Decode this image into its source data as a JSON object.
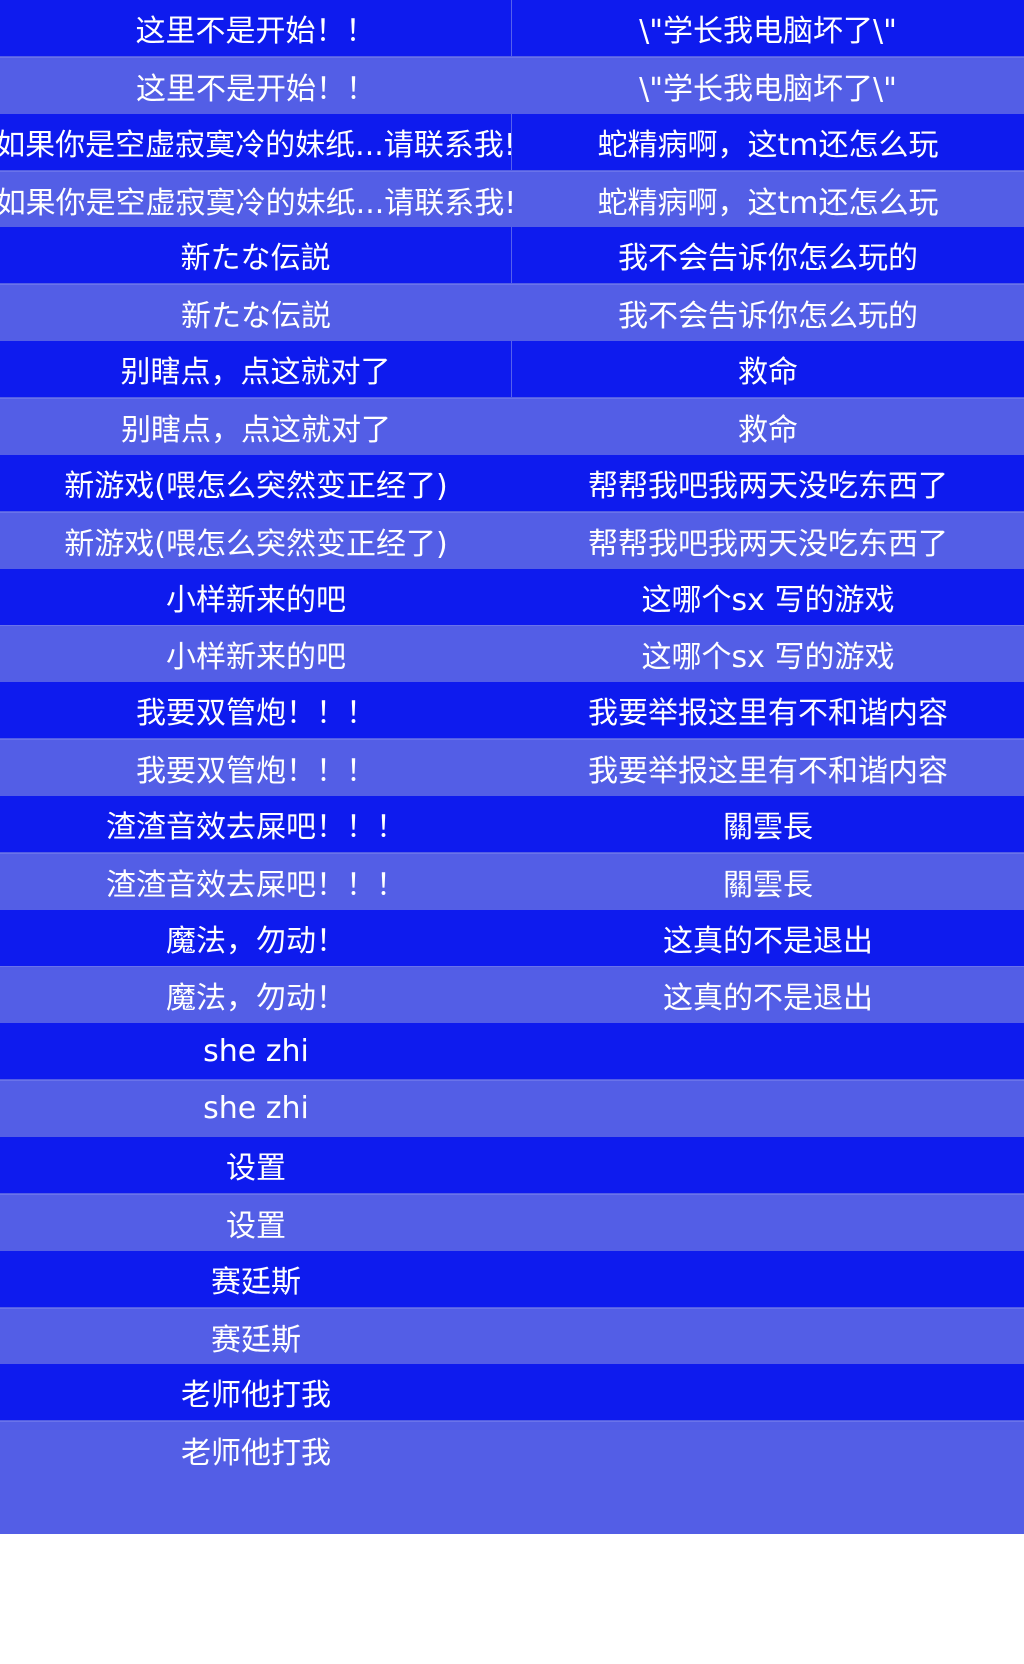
{
  "menu": {
    "rows": [
      {
        "left": "这里不是开始！！",
        "right": "\\\"学长我电脑坏了\\\""
      },
      {
        "left": "这里不是开始！！",
        "right": "\\\"学长我电脑坏了\\\""
      },
      {
        "left": "如果你是空虚寂寞冷的妹纸...请联系我!",
        "right": "蛇精病啊，这tm还怎么玩"
      },
      {
        "left": "如果你是空虚寂寞冷的妹纸...请联系我!",
        "right": "蛇精病啊，这tm还怎么玩"
      },
      {
        "left": "新たな伝説",
        "right": "我不会告诉你怎么玩的"
      },
      {
        "left": "新たな伝説",
        "right": "我不会告诉你怎么玩的"
      },
      {
        "left": "别瞎点，点这就对了",
        "right": "救命"
      },
      {
        "left": "别瞎点，点这就对了",
        "right": "救命"
      },
      {
        "left": "新游戏(喂怎么突然变正经了)",
        "right": "帮帮我吧我两天没吃东西了"
      },
      {
        "left": "新游戏(喂怎么突然变正经了)",
        "right": "帮帮我吧我两天没吃东西了"
      },
      {
        "left": "小样新来的吧",
        "right": "这哪个sx 写的游戏"
      },
      {
        "left": "小样新来的吧",
        "right": "这哪个sx 写的游戏"
      },
      {
        "left": "我要双管炮！！！",
        "right": "我要举报这里有不和谐内容"
      },
      {
        "left": "我要双管炮！！！",
        "right": "我要举报这里有不和谐内容"
      },
      {
        "left": "渣渣音效去屎吧！！！",
        "right": "關雲長"
      },
      {
        "left": "渣渣音效去屎吧！！！",
        "right": "關雲長"
      },
      {
        "left": "魔法，勿动！",
        "right": "这真的不是退出"
      },
      {
        "left": "魔法，勿动！",
        "right": "这真的不是退出"
      },
      {
        "left": "she zhi",
        "right": ""
      },
      {
        "left": "she zhi",
        "right": ""
      },
      {
        "left": "设置",
        "right": ""
      },
      {
        "left": "设置",
        "right": ""
      },
      {
        "left": "赛廷斯",
        "right": ""
      },
      {
        "left": "赛廷斯",
        "right": ""
      },
      {
        "left": "老师他打我",
        "right": ""
      },
      {
        "left": "老师他打我",
        "right": ""
      }
    ]
  },
  "colors": {
    "row_dark": "#0e1bee",
    "row_light": "#535ee6",
    "text": "#ffffff",
    "background": "#ffffff"
  }
}
